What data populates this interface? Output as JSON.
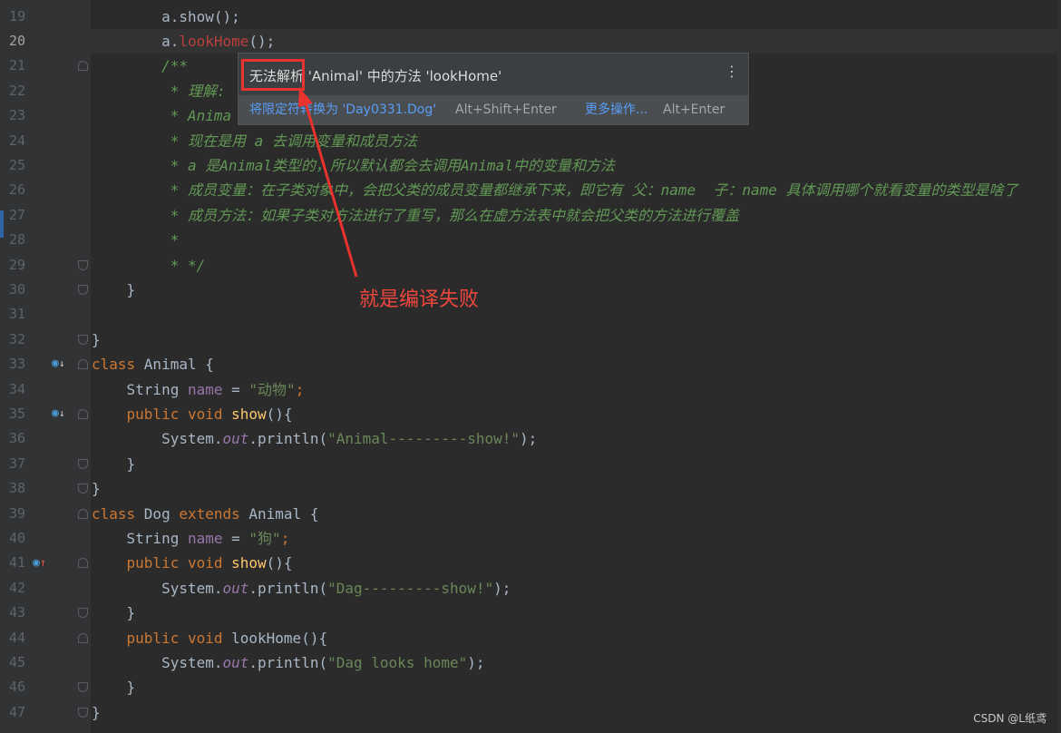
{
  "current_line": 20,
  "lines": [
    {
      "n": "19",
      "tokens": [
        {
          "t": "        a.show();",
          "c": "plain"
        }
      ]
    },
    {
      "n": "20",
      "tokens": [
        {
          "t": "        a.",
          "c": "plain"
        },
        {
          "t": "lookHome",
          "c": "err"
        },
        {
          "t": "();",
          "c": "plain"
        }
      ]
    },
    {
      "n": "21",
      "tokens": [
        {
          "t": "        /**",
          "c": "doc"
        }
      ]
    },
    {
      "n": "22",
      "tokens": [
        {
          "t": "         * 理解:",
          "c": "doc"
        }
      ]
    },
    {
      "n": "23",
      "tokens": [
        {
          "t": "         * Anima",
          "c": "doc"
        }
      ]
    },
    {
      "n": "24",
      "tokens": [
        {
          "t": "         * 现在是用 a 去调用变量和成员方法",
          "c": "doc"
        }
      ]
    },
    {
      "n": "25",
      "tokens": [
        {
          "t": "         * a 是Animal类型的，所以默认都会去调用Animal中的变量和方法",
          "c": "doc"
        }
      ]
    },
    {
      "n": "26",
      "tokens": [
        {
          "t": "         * 成员变量：在子类对象中，会把父类的成员变量都继承下来，即它有 父：name  子：name 具体调用哪个就看变量的类型是啥了",
          "c": "doc"
        }
      ]
    },
    {
      "n": "27",
      "tokens": [
        {
          "t": "         * 成员方法：如果子类对方法进行了重写，那么在虚方法表中就会把父类的方法进行覆盖",
          "c": "doc"
        }
      ]
    },
    {
      "n": "28",
      "tokens": [
        {
          "t": "         *",
          "c": "doc"
        }
      ]
    },
    {
      "n": "29",
      "tokens": [
        {
          "t": "         * */",
          "c": "doc"
        }
      ]
    },
    {
      "n": "30",
      "tokens": [
        {
          "t": "    }",
          "c": "plain"
        }
      ]
    },
    {
      "n": "31",
      "tokens": []
    },
    {
      "n": "32",
      "tokens": [
        {
          "t": "}",
          "c": "plain"
        }
      ]
    },
    {
      "n": "33",
      "tokens": [
        {
          "t": "class ",
          "c": "kw"
        },
        {
          "t": "Animal {",
          "c": "plain"
        }
      ]
    },
    {
      "n": "34",
      "tokens": [
        {
          "t": "    String ",
          "c": "plain"
        },
        {
          "t": "name",
          "c": "fld"
        },
        {
          "t": " = ",
          "c": "plain"
        },
        {
          "t": "\"动物\"",
          "c": "str"
        },
        {
          "t": ";",
          "c": "kw"
        }
      ]
    },
    {
      "n": "35",
      "tokens": [
        {
          "t": "    public void ",
          "c": "kw"
        },
        {
          "t": "show",
          "c": "fn"
        },
        {
          "t": "(){",
          "c": "plain"
        }
      ]
    },
    {
      "n": "36",
      "tokens": [
        {
          "t": "        System.",
          "c": "plain"
        },
        {
          "t": "out",
          "c": "static"
        },
        {
          "t": ".println(",
          "c": "plain"
        },
        {
          "t": "\"Animal---------show!\"",
          "c": "str"
        },
        {
          "t": ");",
          "c": "plain"
        }
      ]
    },
    {
      "n": "37",
      "tokens": [
        {
          "t": "    }",
          "c": "plain"
        }
      ]
    },
    {
      "n": "38",
      "tokens": [
        {
          "t": "}",
          "c": "plain"
        }
      ]
    },
    {
      "n": "39",
      "tokens": [
        {
          "t": "class ",
          "c": "kw"
        },
        {
          "t": "Dog ",
          "c": "plain"
        },
        {
          "t": "extends ",
          "c": "kw"
        },
        {
          "t": "Animal {",
          "c": "plain"
        }
      ]
    },
    {
      "n": "40",
      "tokens": [
        {
          "t": "    String ",
          "c": "plain"
        },
        {
          "t": "name",
          "c": "fld"
        },
        {
          "t": " = ",
          "c": "plain"
        },
        {
          "t": "\"狗\"",
          "c": "str"
        },
        {
          "t": ";",
          "c": "kw"
        }
      ]
    },
    {
      "n": "41",
      "tokens": [
        {
          "t": "    public void ",
          "c": "kw"
        },
        {
          "t": "show",
          "c": "fn"
        },
        {
          "t": "(){",
          "c": "plain"
        }
      ]
    },
    {
      "n": "42",
      "tokens": [
        {
          "t": "        System.",
          "c": "plain"
        },
        {
          "t": "out",
          "c": "static"
        },
        {
          "t": ".println(",
          "c": "plain"
        },
        {
          "t": "\"Dag---------show!\"",
          "c": "str"
        },
        {
          "t": ");",
          "c": "plain"
        }
      ]
    },
    {
      "n": "43",
      "tokens": [
        {
          "t": "    }",
          "c": "plain"
        }
      ]
    },
    {
      "n": "44",
      "tokens": [
        {
          "t": "    public void ",
          "c": "kw"
        },
        {
          "t": "lookHome",
          "c": "plain"
        },
        {
          "t": "(){",
          "c": "plain"
        }
      ]
    },
    {
      "n": "45",
      "tokens": [
        {
          "t": "        System.",
          "c": "plain"
        },
        {
          "t": "out",
          "c": "static"
        },
        {
          "t": ".println(",
          "c": "plain"
        },
        {
          "t": "\"Dag looks home\"",
          "c": "str"
        },
        {
          "t": ");",
          "c": "plain"
        }
      ]
    },
    {
      "n": "46",
      "tokens": [
        {
          "t": "    }",
          "c": "plain"
        }
      ]
    },
    {
      "n": "47",
      "tokens": [
        {
          "t": "}",
          "c": "plain"
        }
      ]
    }
  ],
  "gutter_markers": {
    "33": "implemented-down-icon",
    "35": "implemented-down-icon",
    "41": "overrides-up-icon"
  },
  "popup": {
    "title_highlight": "无法解析",
    "title_rest": " 'Animal' 中的方法 'lookHome'",
    "more_icon": "⋮",
    "action1_label": "将限定符转换为 'Day0331.Dog'",
    "action1_shortcut": "Alt+Shift+Enter",
    "action2_label": "更多操作...",
    "action2_shortcut": "Alt+Enter"
  },
  "annotation": "就是编译失败",
  "watermark": "CSDN @L纸鸢",
  "colors": {
    "background": "#2b2b2b",
    "keyword": "#cc7832",
    "string": "#6a8759",
    "error": "#bc3f3c",
    "doc_comment": "#629755",
    "annotation_red": "#e8332e"
  }
}
